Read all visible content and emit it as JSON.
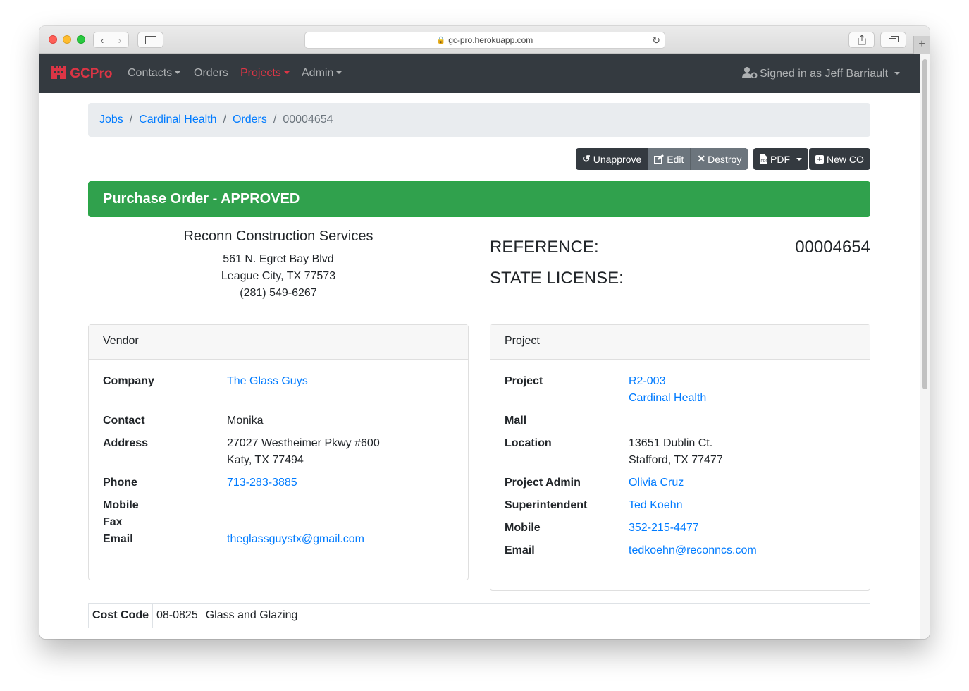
{
  "browser": {
    "url": "gc-pro.herokuapp.com"
  },
  "navbar": {
    "brand": "GCPro",
    "items": [
      {
        "label": "Contacts",
        "has_dropdown": true,
        "active": false
      },
      {
        "label": "Orders",
        "has_dropdown": false,
        "active": false
      },
      {
        "label": "Projects",
        "has_dropdown": true,
        "active": true
      },
      {
        "label": "Admin",
        "has_dropdown": true,
        "active": false
      }
    ],
    "user": "Signed in as Jeff Barriault"
  },
  "breadcrumb": [
    "Jobs",
    "Cardinal Health",
    "Orders",
    "00004654"
  ],
  "actions": {
    "unapprove": "Unapprove",
    "edit": "Edit",
    "destroy": "Destroy",
    "pdf": "PDF",
    "new_co": "New CO"
  },
  "status_banner": "Purchase Order - APPROVED",
  "company": {
    "name": "Reconn Construction Services",
    "address1": "561 N. Egret Bay Blvd",
    "address2": "League City, TX 77573",
    "phone": "(281) 549-6267"
  },
  "reference": {
    "label": "REFERENCE:",
    "value": "00004654"
  },
  "state_license": {
    "label": "STATE LICENSE:",
    "value": ""
  },
  "vendor": {
    "title": "Vendor",
    "company_label": "Company",
    "company": "The Glass Guys",
    "contact_label": "Contact",
    "contact": "Monika",
    "address_label": "Address",
    "address1": "27027 Westheimer Pkwy #600",
    "address2": "Katy, TX 77494",
    "phone_label": "Phone",
    "phone": "713-283-3885",
    "mobile_label": "Mobile",
    "mobile": "",
    "fax_label": "Fax",
    "fax": "",
    "email_label": "Email",
    "email": "theglassguystx@gmail.com"
  },
  "project": {
    "title": "Project",
    "project_label": "Project",
    "project_code": "R2-003",
    "project_name": "Cardinal Health",
    "mall_label": "Mall",
    "mall": "",
    "location_label": "Location",
    "location1": "13651 Dublin Ct.",
    "location2": "Stafford, TX 77477",
    "admin_label": "Project Admin",
    "admin": "Olivia Cruz",
    "super_label": "Superintendent",
    "super": "Ted Koehn",
    "mobile_label": "Mobile",
    "mobile": "352-215-4477",
    "email_label": "Email",
    "email": "tedkoehn@reconncs.com"
  },
  "cost_code": {
    "label": "Cost Code",
    "code": "08-0825",
    "description": "Glass and Glazing"
  },
  "colors": {
    "navbar": "#343a40",
    "brand": "#dc3545",
    "success": "#30a14d",
    "link": "#007bff"
  }
}
